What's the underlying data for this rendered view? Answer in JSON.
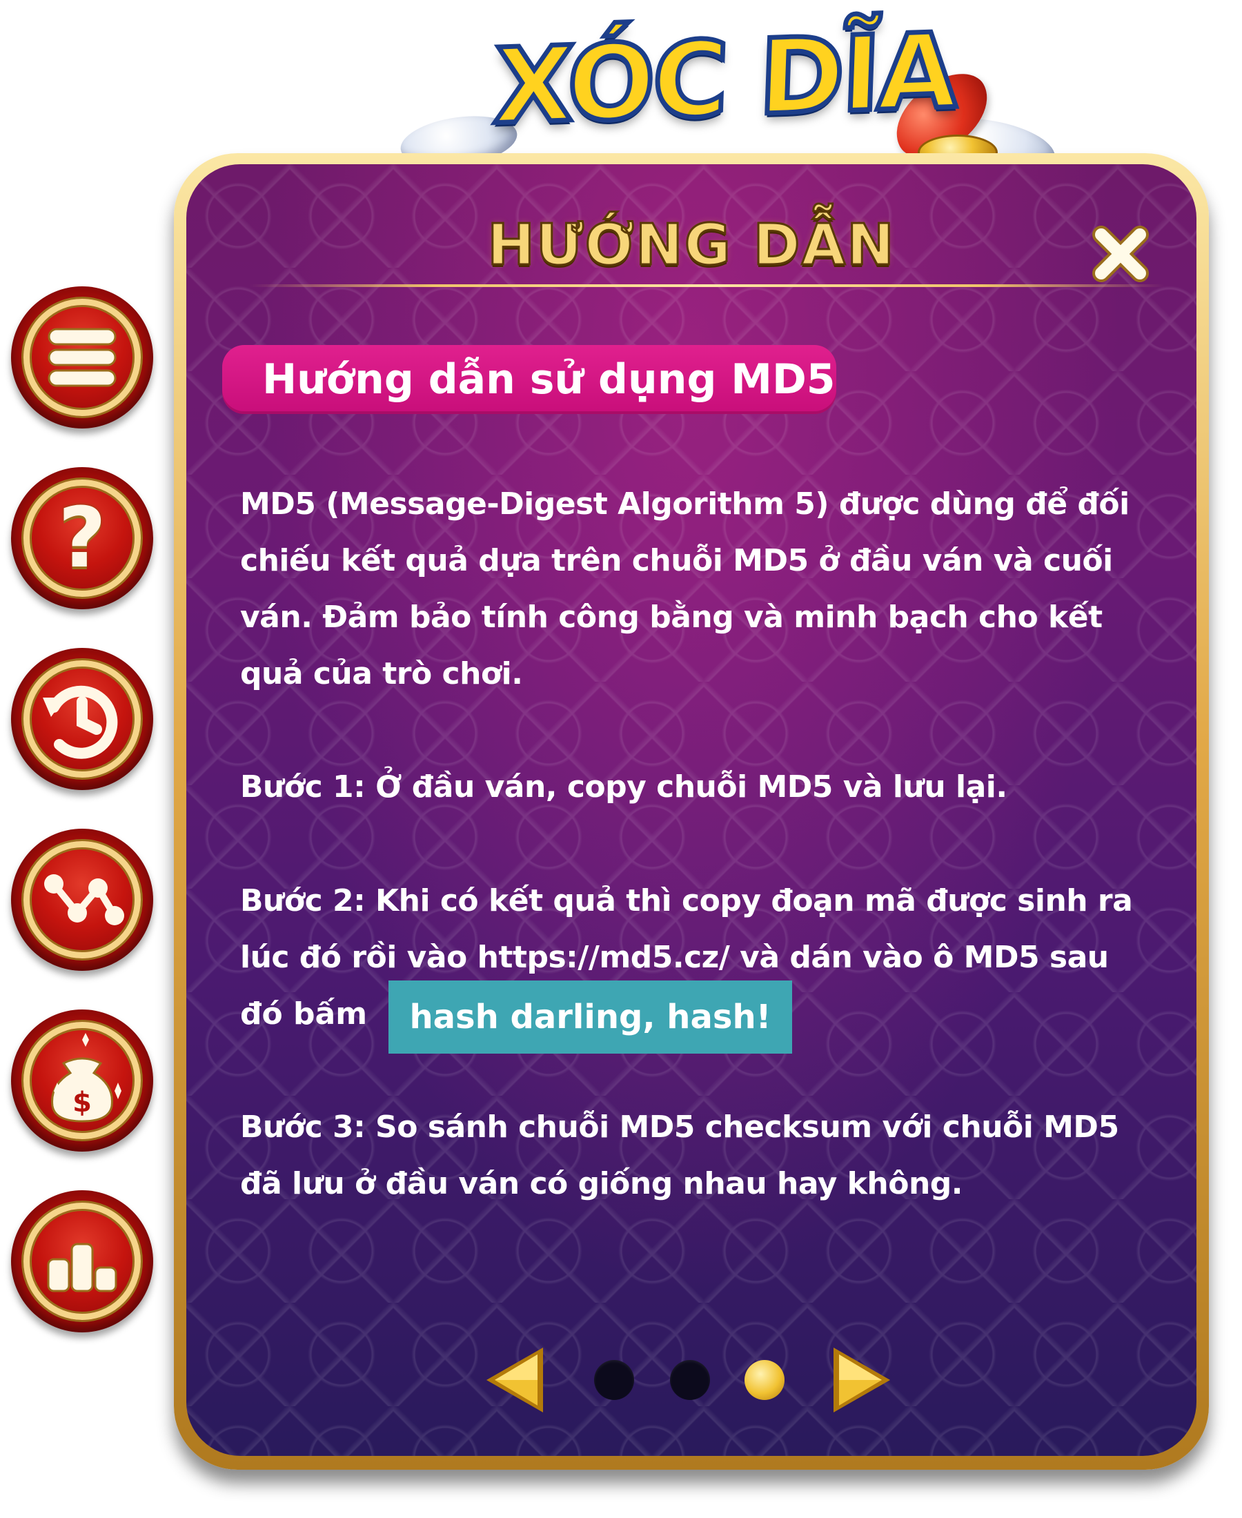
{
  "logo": {
    "text_part1": "XÓC ",
    "text_part2": "DĨA"
  },
  "side_menu": {
    "items": [
      {
        "name": "menu"
      },
      {
        "name": "help"
      },
      {
        "name": "history"
      },
      {
        "name": "stats"
      },
      {
        "name": "money-bag"
      },
      {
        "name": "leaderboard"
      }
    ]
  },
  "dialog": {
    "title": "HƯỚNG DẪN",
    "section_title": "Hướng dẫn sử dụng MD5",
    "paragraph1": "MD5 (Message-Digest Algorithm 5) được dùng để đối chiếu kết quả dựa trên chuỗi MD5 ở đầu ván và cuối ván.  Đảm bảo tính công bằng và minh bạch cho kết quả của trò chơi.",
    "step1": "Bước 1: Ở đầu ván, copy chuỗi MD5 và lưu lại.",
    "step2_text": "Bước 2: Khi có kết quả thì copy đoạn mã được sinh ra lúc đó rồi vào https://md5.cz/ và dán vào ô MD5 sau",
    "step2_tail": "đó bấm",
    "hash_button": "hash darling, hash!",
    "step3": "Bước 3: So sánh chuỗi MD5 checksum với chuỗi MD5 đã lưu ở đầu ván có giống nhau hay không."
  },
  "pager": {
    "total": 3,
    "current": 3
  },
  "colors": {
    "gold": "#f7d67a",
    "pink_pill": "#d6168a",
    "hash_button": "#3ea6b3",
    "red_button": "#b5120d"
  }
}
